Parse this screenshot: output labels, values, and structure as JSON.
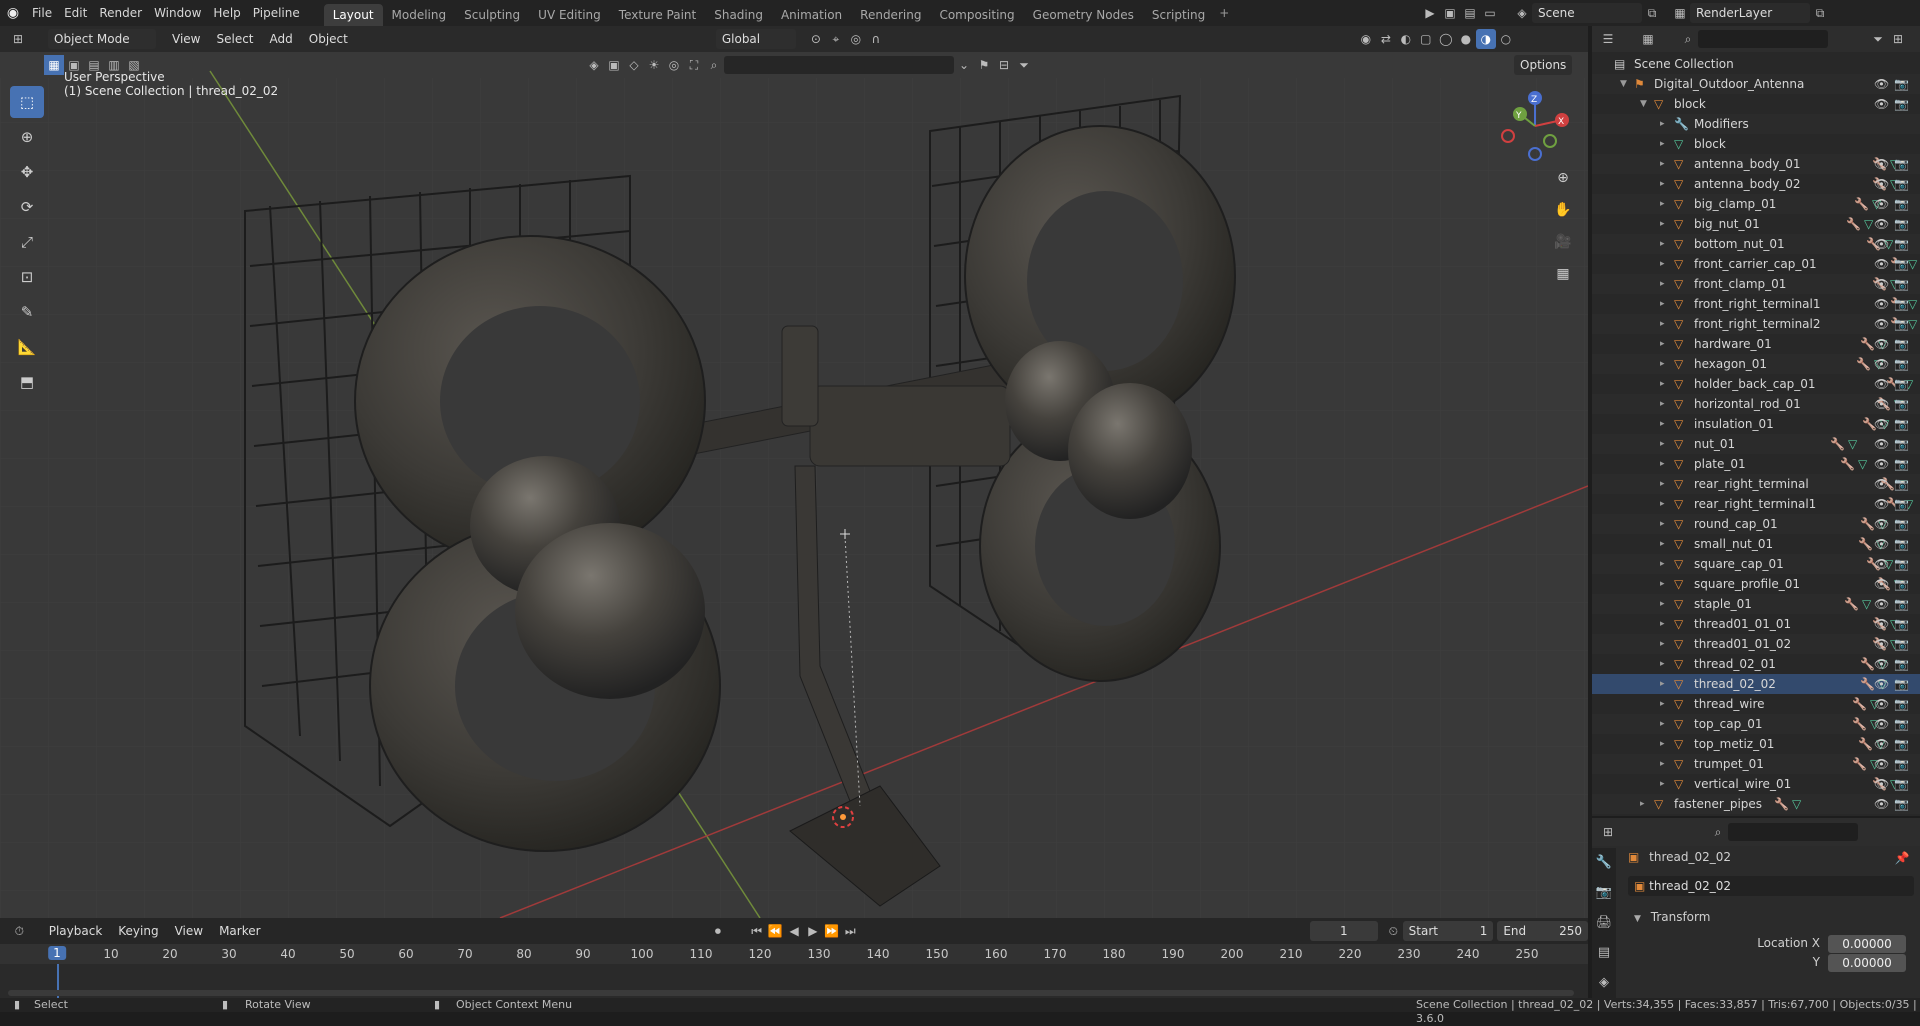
{
  "topbar": {
    "menus": [
      "File",
      "Edit",
      "Render",
      "Window",
      "Help",
      "Pipeline"
    ],
    "workspaces": [
      "Layout",
      "Modeling",
      "Sculpting",
      "UV Editing",
      "Texture Paint",
      "Shading",
      "Animation",
      "Rendering",
      "Compositing",
      "Geometry Nodes",
      "Scripting"
    ],
    "active_workspace": "Layout",
    "scene": "Scene",
    "render_layer": "RenderLayer"
  },
  "viewport": {
    "mode": "Object Mode",
    "menus": [
      "View",
      "Select",
      "Add",
      "Object"
    ],
    "orientation": "Global",
    "options_label": "Options",
    "perspective_label": "User Perspective",
    "collection_label": "(1) Scene Collection | thread_02_02",
    "gizmo_axes": [
      "Z",
      "Y",
      "X"
    ]
  },
  "outliner": {
    "root": "Scene Collection",
    "collection": "Digital_Outdoor_Antenna",
    "parent": "block",
    "modifiers_label": "Modifiers",
    "mesh_data_label": "block",
    "objects": [
      "antenna_body_01",
      "antenna_body_02",
      "big_clamp_01",
      "big_nut_01",
      "bottom_nut_01",
      "front_carrier_cap_01",
      "front_clamp_01",
      "front_right_terminal1",
      "front_right_terminal2",
      "hardware_01",
      "hexagon_01",
      "holder_back_cap_01",
      "horizontal_rod_01",
      "insulation_01",
      "nut_01",
      "plate_01",
      "rear_right_terminal",
      "rear_right_terminal1",
      "round_cap_01",
      "small_nut_01",
      "square_cap_01",
      "square_profile_01",
      "staple_01",
      "thread01_01_01",
      "thread01_01_02",
      "thread_02_01",
      "thread_02_02",
      "thread_wire",
      "top_cap_01",
      "top_metiz_01",
      "trumpet_01",
      "vertical_wire_01"
    ],
    "selected_object": "thread_02_02",
    "last_item": "fastener_pipes"
  },
  "properties": {
    "object_name": "thread_02_02",
    "data_name": "thread_02_02",
    "panel": "Transform",
    "location_x_label": "Location X",
    "location_x": "0.00000",
    "location_y_label": "Y",
    "location_y": "0.00000"
  },
  "timeline": {
    "menus": [
      "Playback",
      "Keying",
      "View",
      "Marker"
    ],
    "current_frame": "1",
    "start_label": "Start",
    "start": "1",
    "end_label": "End",
    "end": "250",
    "ruler_ticks": [
      "10",
      "20",
      "30",
      "40",
      "50",
      "60",
      "70",
      "80",
      "90",
      "100",
      "110",
      "120",
      "130",
      "140",
      "150",
      "160",
      "170",
      "180",
      "190",
      "200",
      "210",
      "220",
      "230",
      "240",
      "250"
    ]
  },
  "statusbar": {
    "select": "Select",
    "rotate": "Rotate View",
    "context": "Object Context Menu",
    "stats": "Scene Collection | thread_02_02 | Verts:34,355 | Faces:33,857 | Tris:67,700 | Objects:0/35 | 3.6.0"
  },
  "colors": {
    "accent": "#4772b3",
    "mesh_icon": "#55c49a",
    "object_icon": "#e0893a",
    "modifier_icon": "#6a8de0"
  }
}
